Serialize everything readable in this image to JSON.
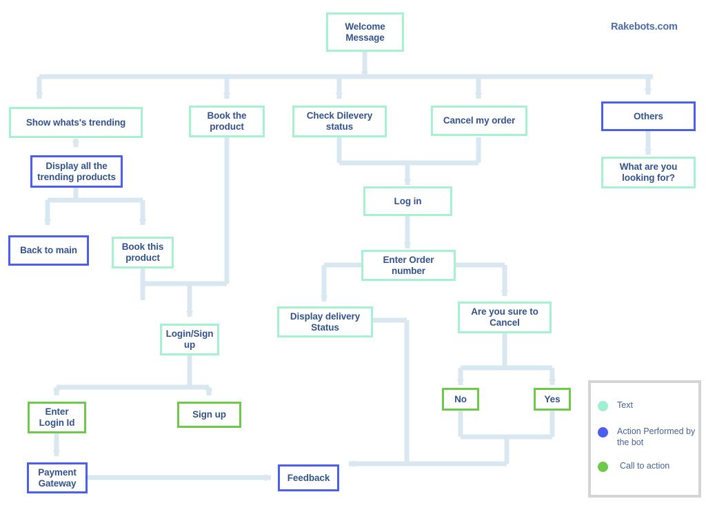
{
  "brand": {
    "label": "Rakebots.com"
  },
  "colors": {
    "text_node": "#a6f2d0",
    "bot_node": "#4a5ff0",
    "cta_node": "#6ec94a",
    "connector": "#d9e8f0",
    "node_text": "#33538f",
    "legend_border": "#d4d4d4",
    "brand_text": "#4d6cae"
  },
  "nodes": [
    {
      "id": "welcome",
      "label": "Welcome Message",
      "type": "text"
    },
    {
      "id": "trending",
      "label": "Show whats's trending",
      "type": "text"
    },
    {
      "id": "book-product",
      "label": "Book the product",
      "type": "text"
    },
    {
      "id": "check-delivery",
      "label": "Check Dilevery status",
      "type": "text"
    },
    {
      "id": "cancel-order",
      "label": "Cancel my order",
      "type": "text"
    },
    {
      "id": "others",
      "label": "Others",
      "type": "bot"
    },
    {
      "id": "display-trending",
      "label": "Display all the trending products",
      "type": "bot"
    },
    {
      "id": "what-looking",
      "label": "What are you looking for?",
      "type": "text"
    },
    {
      "id": "back-to-main",
      "label": "Back to main",
      "type": "bot"
    },
    {
      "id": "book-this",
      "label": "Book this product",
      "type": "text"
    },
    {
      "id": "login",
      "label": "Log in",
      "type": "text"
    },
    {
      "id": "enter-order",
      "label": "Enter Order number",
      "type": "text"
    },
    {
      "id": "login-signup",
      "label": "Login/Sign up",
      "type": "text"
    },
    {
      "id": "display-delivery",
      "label": "Display delivery Status",
      "type": "text"
    },
    {
      "id": "are-you-sure",
      "label": "Are you sure to Cancel",
      "type": "text"
    },
    {
      "id": "enter-login-id",
      "label": "Enter Login Id",
      "type": "cta"
    },
    {
      "id": "signup",
      "label": "Sign up",
      "type": "cta"
    },
    {
      "id": "no",
      "label": "No",
      "type": "cta"
    },
    {
      "id": "yes",
      "label": "Yes",
      "type": "cta"
    },
    {
      "id": "payment-gateway",
      "label": "Payment Gateway",
      "type": "bot"
    },
    {
      "id": "feedback",
      "label": "Feedback",
      "type": "bot"
    }
  ],
  "legend": {
    "items": [
      {
        "color": "#9ff0cf",
        "label": "Text"
      },
      {
        "color": "#4a5ff0",
        "label": "Action Performed by the bot"
      },
      {
        "color": "#6ec94a",
        "label": "Call to action"
      }
    ]
  }
}
